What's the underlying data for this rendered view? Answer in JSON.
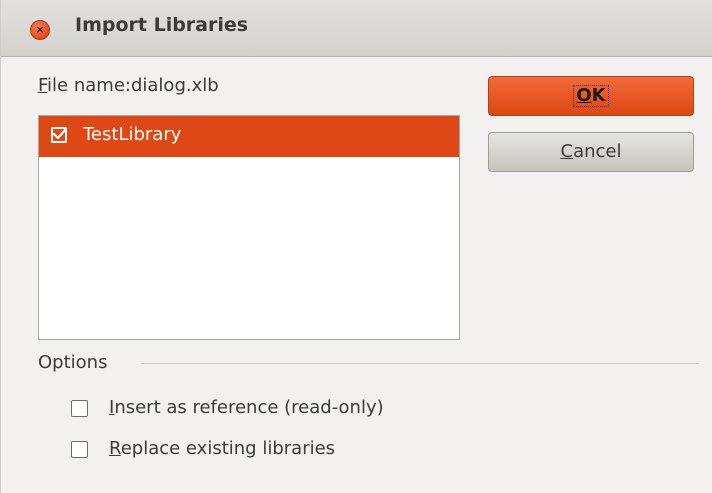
{
  "window": {
    "title": "Import Libraries",
    "close_icon": "close-icon"
  },
  "file": {
    "label_mnemonic": "F",
    "label_rest": "ile name:",
    "value": "dialog.xlb"
  },
  "libraries": [
    {
      "label": "TestLibrary",
      "checked": true,
      "selected": true
    }
  ],
  "buttons": {
    "ok_mnemonic": "O",
    "ok_rest": "K",
    "cancel_mnemonic": "C",
    "cancel_rest": "ancel"
  },
  "options": {
    "title": "Options",
    "insert_reference": {
      "mnemonic": "I",
      "rest": "nsert as reference (read-only)",
      "checked": false
    },
    "replace_existing": {
      "mnemonic": "R",
      "rest": "eplace existing libraries",
      "checked": false
    }
  },
  "colors": {
    "accent": "#dd4814",
    "dialog_bg": "#f2f1f0"
  }
}
